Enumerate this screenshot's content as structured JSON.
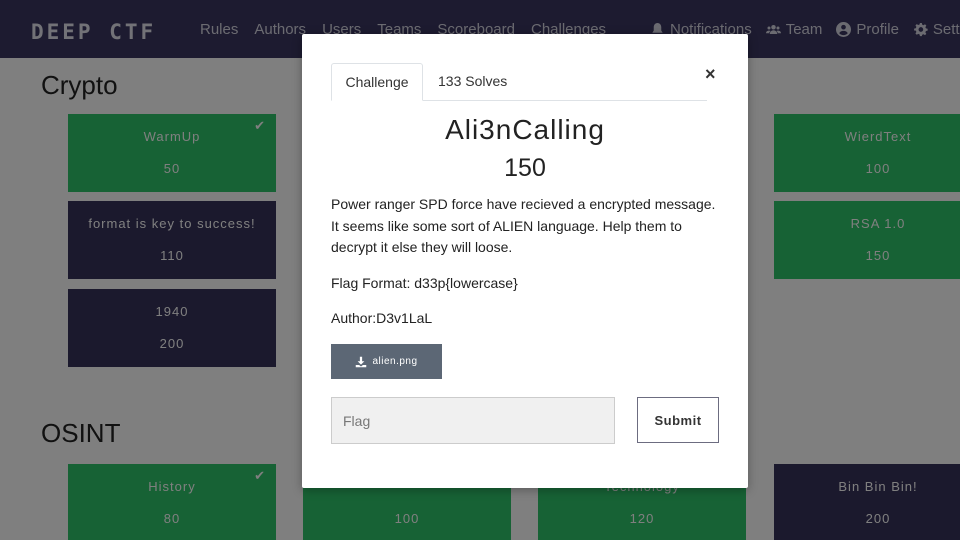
{
  "navbar": {
    "logo": "DEEP CTF",
    "left_links": [
      "Rules",
      "Authors",
      "Users",
      "Teams",
      "Scoreboard",
      "Challenges"
    ],
    "notifications": "Notifications",
    "team": "Team",
    "profile": "Profile",
    "settings": "Settings"
  },
  "sections": [
    {
      "title": "Crypto"
    },
    {
      "title": "OSINT"
    }
  ],
  "cards": {
    "warmup": {
      "name": "WarmUp",
      "points": "50",
      "solved": true
    },
    "format": {
      "name": "format is key to success!",
      "points": "110",
      "solved": false
    },
    "c1940": {
      "name": "1940",
      "points": "200",
      "solved": false
    },
    "wierd": {
      "name": "WierdText",
      "points": "100",
      "solved": true
    },
    "rsa": {
      "name": "RSA 1.0",
      "points": "150",
      "solved": true
    },
    "history": {
      "name": "History",
      "points": "80",
      "solved": true
    },
    "osint2": {
      "name": "",
      "points": "100",
      "solved": true
    },
    "technology": {
      "name": "Technology",
      "points": "120",
      "solved": true
    },
    "binbin": {
      "name": "Bin Bin Bin!",
      "points": "200",
      "solved": false
    }
  },
  "modal": {
    "tab_challenge": "Challenge",
    "tab_solves": "133 Solves",
    "close": "×",
    "name": "Ali3nCalling",
    "value": "150",
    "description": "Power ranger SPD force have recieved a encrypted message. It seems like some sort of ALIEN language. Help them to decrypt it else they will loose.",
    "flag_format": "Flag Format: d33p{lowercase}",
    "author": "Author:D3v1LaL",
    "file": "alien.png",
    "flag_placeholder": "Flag",
    "submit": "Submit"
  },
  "colors": {
    "navbar": "#3b3760",
    "solved": "#2ec46a",
    "unsolved": "#37335a",
    "file_button": "#5c6775"
  }
}
